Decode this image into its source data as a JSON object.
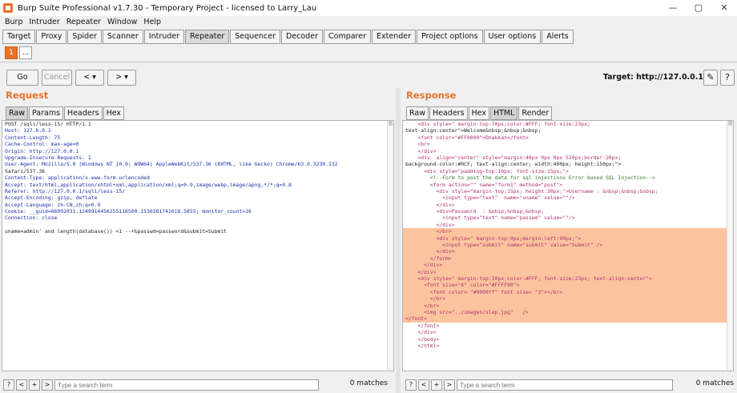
{
  "window": {
    "title": "Burp Suite Professional v1.7.30 - Temporary Project - licensed to Larry_Lau",
    "minimize": "—",
    "maximize": "▢",
    "close": "✕"
  },
  "menu": [
    "Burp",
    "Intruder",
    "Repeater",
    "Window",
    "Help"
  ],
  "tabs": [
    "Target",
    "Proxy",
    "Spider",
    "Scanner",
    "Intruder",
    "Repeater",
    "Sequencer",
    "Decoder",
    "Comparer",
    "Extender",
    "Project options",
    "User options",
    "Alerts"
  ],
  "active_tab": "Repeater",
  "subtabs": [
    "1",
    "..."
  ],
  "toolbar": {
    "go": "Go",
    "cancel": "Cancel",
    "back": "< ▾",
    "forward": "> ▾",
    "target": "Target: http://127.0.0.1",
    "edit_icon": "pencil-icon",
    "help_icon": "question-icon"
  },
  "request": {
    "title": "Request",
    "tabs": [
      "Raw",
      "Params",
      "Headers",
      "Hex"
    ],
    "lines": [
      "POST /sqli/less-15/ HTTP/1.1",
      "Host: 127.0.0.1",
      "Content-Length: 75",
      "Cache-Control: max-age=0",
      "Origin: http://127.0.0.1",
      "Upgrade-Insecure-Requests: 1",
      "User-Agent: Mozilla/5.0 (Windows NT 10.0; WOW64) AppleWebKit/537.36 (KHTML, like Gecko) Chrome/63.0.3239.132",
      "Safari/537.36",
      "Content-Type: application/x-www-form-urlencoded",
      "Accept: text/html,application/xhtml+xml,application/xml;q=0.9,image/webp,image/apng,*/*;q=0.8",
      "Referer: http://127.0.0.1/sqli/less-15/",
      "Accept-Encoding: gzip, deflate",
      "Accept-Language: zh-CN,zh;q=0.9",
      "Cookie: __guid=66992031.1249914456255116500.1530381741618.5655; monitor_count=16",
      "Connection: close",
      "",
      "uname=admin' and length(database()) <1 --+&passwd=password&submit=Submit"
    ],
    "search_placeholder": "Type a search term",
    "matches": "0 matches"
  },
  "response": {
    "title": "Response",
    "tabs": [
      "Raw",
      "Headers",
      "Hex",
      "HTML",
      "Render"
    ],
    "lines": [
      "    <div style=\" margin-top:70px;color:#FFF; font-size:23px;",
      "text-align:center\">Welcome&nbsp;&nbsp;&nbsp;",
      "    <font color=\"#FF0000\">Dhakkan</font>",
      "    <br>",
      "    </div>",
      "    <div  align=\"center\" style=\"margin:40px 0px 0px 520px;border:20px;",
      "background-color:#0CF; text-align:center; width:400px; height:150px;\">",
      "      <div style=\"padding-top:10px; font-size:15px;\">",
      "        <!--Form to post the data for sql injections Error based SQL Injection-->",
      "        <form action=\"\" name=\"form1\" method=\"post\">",
      "          <div style=\"margin-top:15px; height:30px;\">Username : &nbsp;&nbsp;&nbsp;",
      "            <input type=\"text\"  name=\"uname\" value=\"\"/>",
      "          </div>",
      "          <div>Password  : &nbsp;&nbsp;&nbsp;",
      "            <input type=\"text\" name=\"passwd\" value=\"\"/>",
      "          </div>",
      "          </br>",
      "          <div style=\" margin-top:9px;margin-left:90px;\">",
      "            <input type=\"submit\" name=\"submit\" value=\"Submit\" />",
      "          </div>",
      "        </form>",
      "      </div>",
      "    </div>",
      "    <div style=\" margin-top:10px;color:#FFF; font-size:23px; text-align:center\">",
      "      <font size=\"6\" color=\"#FFFF00\">",
      "        <font color= \"#0000ff\" font size= \"3\"></br>",
      "        </br>",
      "      </br>",
      "      <img src=\"../images/slap.jpg\"   />",
      "</font>",
      "    </font>",
      "    </div>",
      "    </body>",
      "    </html>"
    ],
    "highlight_from": 16,
    "highlight_to": 29,
    "search_placeholder": "Type a search term",
    "matches": "0 matches"
  },
  "colors": {
    "accent": "#e8742a",
    "highlight": "#fbc49f"
  }
}
